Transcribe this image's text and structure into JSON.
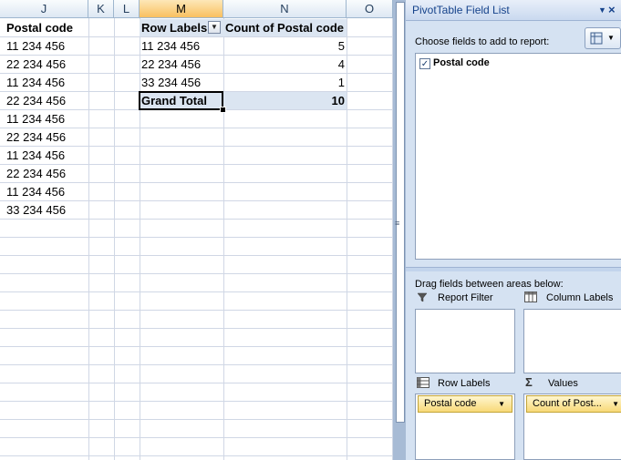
{
  "columns": [
    "J",
    "K",
    "L",
    "M",
    "N",
    "O"
  ],
  "table": {
    "header": "Postal code",
    "values": [
      "11 234 456",
      "22 234 456",
      "11 234 456",
      "22 234 456",
      "11 234 456",
      "22 234 456",
      "11 234 456",
      "22 234 456",
      "11 234 456",
      "33 234 456"
    ]
  },
  "pivot": {
    "header_labels": "Row Labels",
    "header_count": "Count of Postal code",
    "rows": [
      {
        "label": "11 234 456",
        "count": "5"
      },
      {
        "label": "22 234 456",
        "count": "4"
      },
      {
        "label": "33 234 456",
        "count": "1"
      }
    ],
    "total_label": "Grand Total",
    "total_value": "10"
  },
  "pane": {
    "title": "PivotTable Field List",
    "choose_text": "Choose fields to add to report:",
    "fields": [
      {
        "name": "Postal code",
        "checked": true
      }
    ],
    "drag_text": "Drag fields between areas below:",
    "report_filter": "Report Filter",
    "column_labels": "Column Labels",
    "row_labels": "Row Labels",
    "values": "Values",
    "row_field": "Postal code",
    "value_field": "Count of Post..."
  }
}
